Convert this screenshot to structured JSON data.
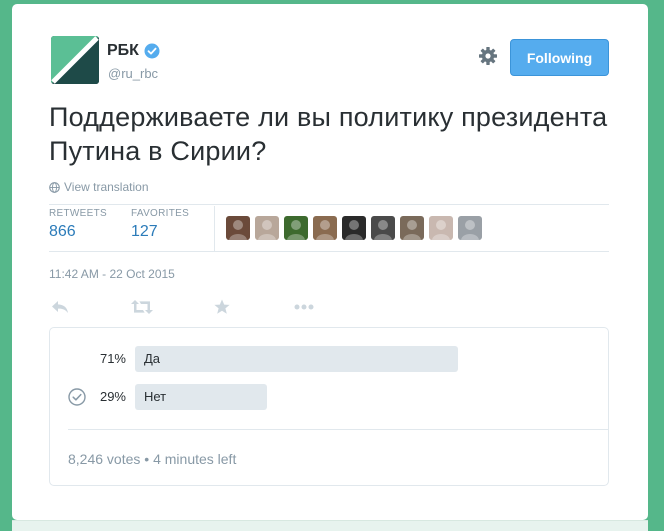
{
  "tweet": {
    "author_name": "РБК",
    "author_handle": "@ru_rbc",
    "follow_label": "Following",
    "text": "Поддерживаете ли вы политику президента Путина в Сирии?",
    "translate_label": "View translation",
    "stats": {
      "retweets_label": "RETWEETS",
      "retweets_value": "866",
      "favorites_label": "FAVORITES",
      "favorites_value": "127"
    },
    "timestamp": "11:42 AM - 22 Oct 2015"
  },
  "favoriters": [
    {
      "name": "favoriter-avatar",
      "color": "#6b4a3a"
    },
    {
      "name": "favoriter-avatar",
      "color": "#b8a79a"
    },
    {
      "name": "favoriter-avatar",
      "color": "#3d6a2e"
    },
    {
      "name": "favoriter-avatar",
      "color": "#8a6b50"
    },
    {
      "name": "favoriter-avatar",
      "color": "#2a2a2a"
    },
    {
      "name": "favoriter-avatar",
      "color": "#4a4a4a"
    },
    {
      "name": "favoriter-avatar",
      "color": "#7a6a5a"
    },
    {
      "name": "favoriter-avatar",
      "color": "#c9b8b0"
    },
    {
      "name": "favoriter-avatar",
      "color": "#9aa0a6"
    }
  ],
  "poll": {
    "options": [
      {
        "percent_label": "71%",
        "label": "Да",
        "percent": 71,
        "selected": false
      },
      {
        "percent_label": "29%",
        "label": "Нет",
        "percent": 29,
        "selected": true
      }
    ],
    "votes": "8,246 votes",
    "separator": "•",
    "time_left": "4 minutes left"
  },
  "colors": {
    "background": "#55b78a",
    "link_blue": "#2b7bb9",
    "follow_button": "#55acee",
    "muted": "#8899a6",
    "poll_bar": "#e1e8ed"
  },
  "icons": [
    "rbc-logo",
    "verified-badge-icon",
    "gear-icon",
    "globe-icon",
    "reply-icon",
    "retweet-icon",
    "favorite-star-icon",
    "more-dots-icon",
    "check-circle-icon"
  ]
}
